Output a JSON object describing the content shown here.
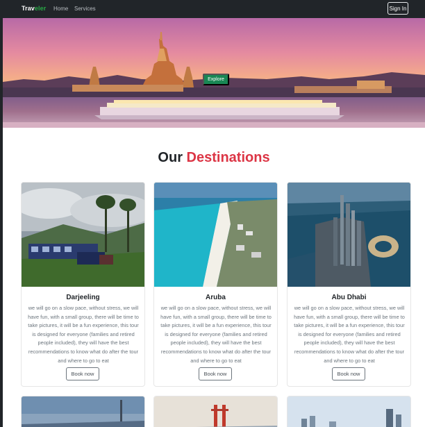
{
  "navbar": {
    "brand_main": "Trav",
    "brand_accent": "eler",
    "links": [
      "Home",
      "Services"
    ],
    "signin_label": "Sign In"
  },
  "hero": {
    "button_label": "Explore"
  },
  "section": {
    "heading_main": "Our",
    "heading_accent": "Destinations"
  },
  "cards": [
    {
      "title": "Darjeeling",
      "text": "we will go on a slow pace, without stress, we will have fun, with a small group, there will be time to take pictures, it will be a fun experience, this tour is designed for everyone (families and retired people included), they will have the best recommendations to know what do after the tour and where to go to eat",
      "button": "Book now"
    },
    {
      "title": "Aruba",
      "text": "we will go on a slow pace, without stress, we will have fun, with a small group, there will be time to take pictures, it will be a fun experience, this tour is designed for everyone (families and retired people included), they will have the best recommendations to know what do after the tour and where to go to eat",
      "button": "Book now"
    },
    {
      "title": "Abu Dhabi",
      "text": "we will go on a slow pace, without stress, we will have fun, with a small group, there will be time to take pictures, it will be a fun experience, this tour is designed for everyone (families and retired people included), they will have the best recommendations to know what do after the tour and where to go to eat",
      "button": "Book now"
    }
  ],
  "colors": {
    "navbar_bg": "#212529",
    "accent_green": "#198754",
    "heading_red": "#dc3545"
  }
}
